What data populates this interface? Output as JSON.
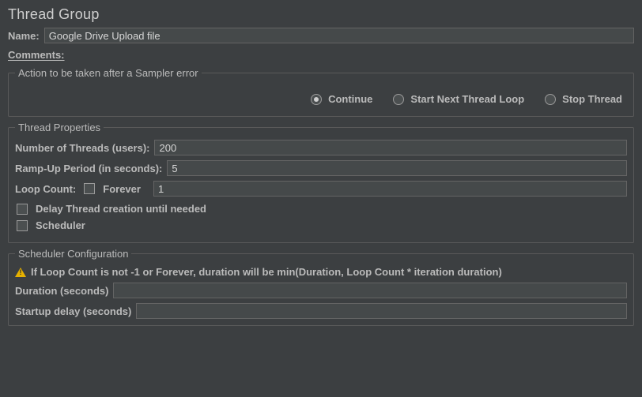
{
  "title": "Thread Group",
  "name": {
    "label": "Name:",
    "value": "Google Drive Upload file"
  },
  "comments": {
    "label": "Comments:",
    "value": ""
  },
  "samplerError": {
    "legend": "Action to be taken after a Sampler error",
    "options": {
      "continue": "Continue",
      "startNext": "Start Next Thread Loop",
      "stopThread": "Stop Thread"
    },
    "selected": "continue"
  },
  "threadProps": {
    "legend": "Thread Properties",
    "numThreads": {
      "label": "Number of Threads (users):",
      "value": "200"
    },
    "rampUp": {
      "label": "Ramp-Up Period (in seconds):",
      "value": "5"
    },
    "loopCount": {
      "label": "Loop Count:",
      "forever": "Forever",
      "value": "1"
    },
    "delayThread": "Delay Thread creation until needed",
    "scheduler": "Scheduler"
  },
  "schedulerConfig": {
    "legend": "Scheduler Configuration",
    "warning": "If Loop Count is not -1 or Forever, duration will be min(Duration, Loop Count * iteration duration)",
    "duration": {
      "label": "Duration (seconds)",
      "value": ""
    },
    "startupDelay": {
      "label": "Startup delay (seconds)",
      "value": ""
    }
  }
}
